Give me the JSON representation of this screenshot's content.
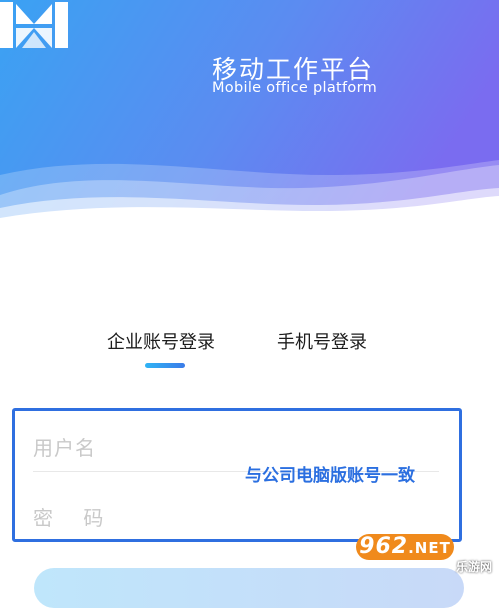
{
  "app": {
    "title": "移动工作平台",
    "subtitle": "Mobile office platform"
  },
  "login_tabs": [
    {
      "label": "企业账号登录",
      "active": true
    },
    {
      "label": "手机号登录",
      "active": false
    }
  ],
  "form": {
    "username_placeholder": "用户名",
    "password_placeholder": "密 码",
    "annotation": "与公司电脑版账号一致"
  },
  "watermark": {
    "badge": "962",
    "badge_suffix": ".NET",
    "subtitle": "乐游网"
  },
  "colors": {
    "header_gradient_start": "#3a9bf2",
    "header_gradient_end": "#7b6df0",
    "accent": "#2f6fe0",
    "tab_indicator": "#2fb4f5"
  }
}
